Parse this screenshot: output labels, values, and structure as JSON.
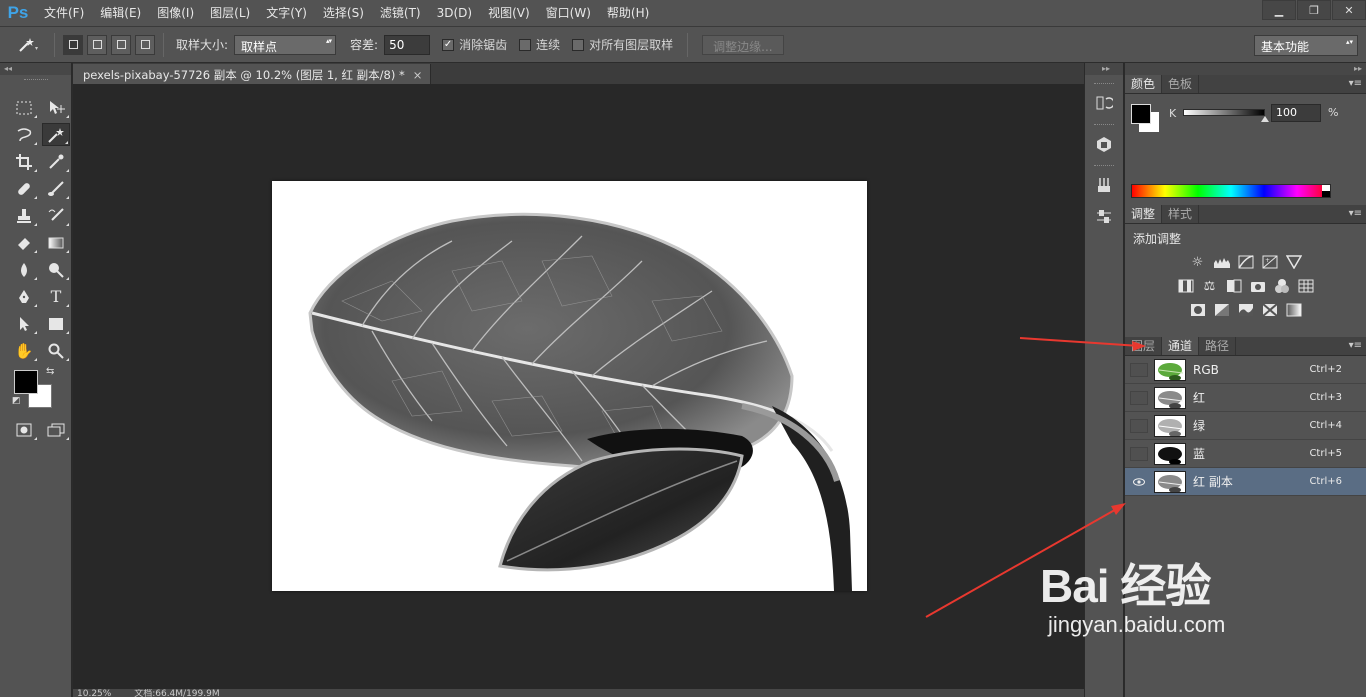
{
  "app": {
    "logo": "Ps"
  },
  "menu": [
    "文件(F)",
    "编辑(E)",
    "图像(I)",
    "图层(L)",
    "文字(Y)",
    "选择(S)",
    "滤镜(T)",
    "3D(D)",
    "视图(V)",
    "窗口(W)",
    "帮助(H)"
  ],
  "window_controls": {
    "minimize": "▁",
    "restore": "❐",
    "close": "✕"
  },
  "options": {
    "sample_size_label": "取样大小:",
    "sample_size_value": "取样点",
    "tolerance_label": "容差:",
    "tolerance_value": "50",
    "anti_alias_label": "消除锯齿",
    "anti_alias_checked": true,
    "contiguous_label": "连续",
    "contiguous_checked": false,
    "sample_all_label": "对所有图层取样",
    "sample_all_checked": false,
    "refine_edge_label": "调整边缘...",
    "workspace": "基本功能"
  },
  "document": {
    "tab_title": "pexels-pixabay-57726 副本 @ 10.2% (图层 1, 红 副本/8) *",
    "close_glyph": "×",
    "status_zoom": "10.25%",
    "status_doc": "文档:66.4M/199.9M"
  },
  "toolbox": {
    "tools": [
      "marquee-tool",
      "move-tool",
      "lasso-tool",
      "magic-wand-tool",
      "crop-tool",
      "eyedropper-tool",
      "healing-brush-tool",
      "brush-tool",
      "clone-stamp-tool",
      "history-brush-tool",
      "eraser-tool",
      "gradient-tool",
      "blur-tool",
      "dodge-tool",
      "pen-tool",
      "type-tool",
      "path-selection-tool",
      "rectangle-tool",
      "hand-tool",
      "zoom-tool"
    ],
    "active_tool": "magic-wand-tool",
    "foreground_color": "#000000",
    "background_color": "#ffffff"
  },
  "color_panel": {
    "tabs": [
      "颜色",
      "色板"
    ],
    "active_tab": "颜色",
    "channel_label": "K",
    "value": "100",
    "unit": "%"
  },
  "adjustments_panel": {
    "tabs": [
      "调整",
      "样式"
    ],
    "active_tab": "调整",
    "title": "添加调整"
  },
  "channels_panel": {
    "tabs": [
      "图层",
      "通道",
      "路径"
    ],
    "active_tab": "通道",
    "channels": [
      {
        "name": "RGB",
        "shortcut": "Ctrl+2",
        "visible": false,
        "selected": false,
        "thumb": "rgb"
      },
      {
        "name": "红",
        "shortcut": "Ctrl+3",
        "visible": false,
        "selected": false,
        "thumb": "red"
      },
      {
        "name": "绿",
        "shortcut": "Ctrl+4",
        "visible": false,
        "selected": false,
        "thumb": "green"
      },
      {
        "name": "蓝",
        "shortcut": "Ctrl+5",
        "visible": false,
        "selected": false,
        "thumb": "blue"
      },
      {
        "name": "红 副本",
        "shortcut": "Ctrl+6",
        "visible": true,
        "selected": true,
        "thumb": "redcopy"
      }
    ]
  },
  "annotations": {
    "arrow_color": "#e8382f"
  },
  "watermark": {
    "main": "Bai 经验",
    "sub": "jingyan.baidu.com"
  }
}
